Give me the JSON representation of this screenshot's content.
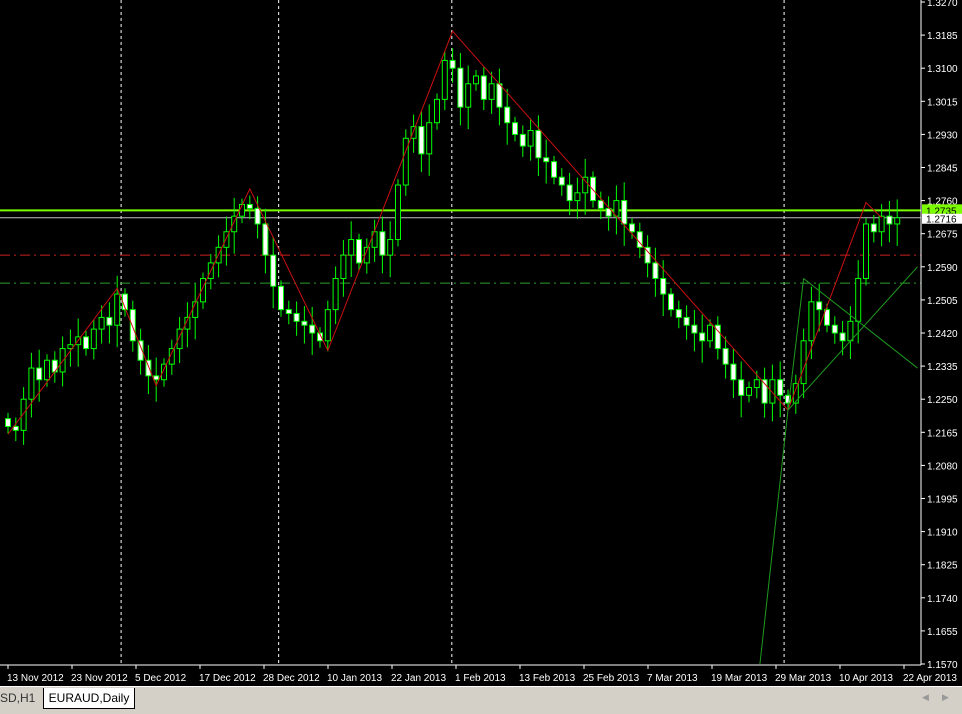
{
  "chart_data": {
    "type": "candlestick",
    "symbol": "EURAUD",
    "timeframe": "Daily",
    "ylim": [
      1.157,
      1.327
    ],
    "y_ticks": [
      "1.3270",
      "1.3185",
      "1.3100",
      "1.3015",
      "1.2930",
      "1.2845",
      "1.2760",
      "1.2675",
      "1.2590",
      "1.2505",
      "1.2420",
      "1.2335",
      "1.2250",
      "1.2165",
      "1.2080",
      "1.1995",
      "1.1910",
      "1.1825",
      "1.1740",
      "1.1655",
      "1.1570"
    ],
    "x_labels": [
      "13 Nov 2012",
      "23 Nov 2012",
      "5 Dec 2012",
      "17 Dec 2012",
      "28 Dec 2012",
      "10 Jan 2013",
      "22 Jan 2013",
      "1 Feb 2013",
      "13 Feb 2013",
      "25 Feb 2013",
      "7 Mar 2013",
      "19 Mar 2013",
      "29 Mar 2013",
      "10 Apr 2013",
      "22 Apr 2013"
    ],
    "first_open": 1.22,
    "closes": [
      1.218,
      1.217,
      1.225,
      1.233,
      1.23,
      1.235,
      1.232,
      1.238,
      1.239,
      1.241,
      1.238,
      1.243,
      1.246,
      1.244,
      1.252,
      1.248,
      1.24,
      1.235,
      1.231,
      1.23,
      1.234,
      1.238,
      1.243,
      1.246,
      1.25,
      1.256,
      1.26,
      1.264,
      1.268,
      1.272,
      1.275,
      1.274,
      1.27,
      1.262,
      1.254,
      1.248,
      1.247,
      1.245,
      1.244,
      1.242,
      1.24,
      1.248,
      1.256,
      1.262,
      1.266,
      1.26,
      1.264,
      1.268,
      1.262,
      1.266,
      1.28,
      1.292,
      1.295,
      1.288,
      1.296,
      1.302,
      1.312,
      1.31,
      1.3,
      1.306,
      1.308,
      1.302,
      1.306,
      1.3,
      1.296,
      1.293,
      1.29,
      1.294,
      1.287,
      1.286,
      1.282,
      1.28,
      1.276,
      1.278,
      1.282,
      1.276,
      1.274,
      1.272,
      1.276,
      1.27,
      1.268,
      1.264,
      1.26,
      1.256,
      1.252,
      1.248,
      1.246,
      1.244,
      1.242,
      1.24,
      1.244,
      1.238,
      1.234,
      1.23,
      1.226,
      1.228,
      1.23,
      1.224,
      1.23,
      1.226,
      1.224,
      1.229,
      1.24,
      1.25,
      1.248,
      1.244,
      1.242,
      1.24,
      1.245,
      1.256,
      1.27,
      1.268,
      1.272,
      1.27,
      1.2716
    ],
    "zigzag": [
      [
        0,
        1.216
      ],
      [
        14,
        1.2535
      ],
      [
        19,
        1.2285
      ],
      [
        31,
        1.279
      ],
      [
        41,
        1.2375
      ],
      [
        57,
        1.3195
      ],
      [
        100,
        1.2222
      ],
      [
        110,
        1.2755
      ],
      [
        112,
        1.2716
      ]
    ],
    "hlines": [
      {
        "name": "ask-line",
        "price": 1.2735,
        "color": "#7cfc00",
        "style": "solid"
      },
      {
        "name": "bid-line",
        "price": 1.2716,
        "color": "#c0c0c0",
        "style": "solid"
      },
      {
        "name": "red-level",
        "price": 1.262,
        "color": "#cc2020",
        "style": "dashdot"
      },
      {
        "name": "green-level",
        "price": 1.2548,
        "color": "#2e9e2e",
        "style": "dashdot"
      }
    ],
    "trendlines": [
      [
        [
          96.4,
          1.157
        ],
        [
          100,
          1.2222
        ]
      ],
      [
        [
          100,
          1.2222
        ],
        [
          116.6,
          1.259
        ]
      ],
      [
        [
          102,
          1.256
        ],
        [
          116.6,
          1.233
        ]
      ],
      [
        [
          100,
          1.2222
        ],
        [
          102,
          1.256
        ]
      ]
    ],
    "ask_label": "1.2735",
    "bid_label": "1.2716",
    "colors": {
      "candle": "#00ff00",
      "zigzag": "#cc1010",
      "trend": "#1f9a1f",
      "ask_bg": "#7cfc00",
      "bid_bg": "#ffffff"
    }
  },
  "tabs": {
    "inactive": "SD,H1",
    "active": "EURAUD,Daily"
  }
}
